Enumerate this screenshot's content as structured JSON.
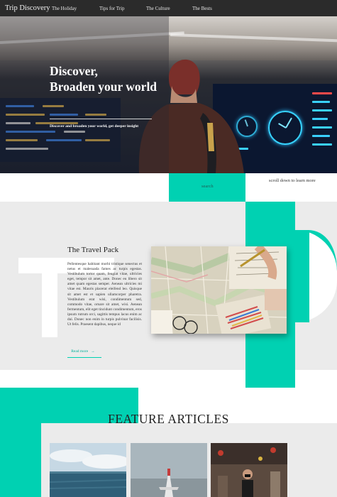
{
  "nav": {
    "brand": "Trip Discovery",
    "links": [
      "The Holiday",
      "Tips for Trip",
      "The Culture",
      "The Bests"
    ]
  },
  "hero": {
    "title_line1": "Discover,",
    "title_line2": "Broaden your world",
    "subtitle": "Discover and broaden your world, get deeper insight"
  },
  "search": {
    "label": "search"
  },
  "scroll_hint": "scroll down to learn more",
  "travel_pack": {
    "title": "The Travel Pack",
    "body": "Pellentesque habitant morbi tristique senectus et netus et malesuada fames ac turpis egestas. Vestibulum tortor quam, feugiat vitae, ultricies eget, tempor sit amet, ante. Donec eu libero sit amet quam egestas semper. Aenean ultricies mi vitae est. Mauris placerat eleifend leo. Quisque sit amet est et sapien ullamcorper pharetra. Vestibulum erat wisi, condimentum sed, commodo vitae, ornare sit amet, wisi. Aenean fermentum, elit eget tincidunt condimentum, eros ipsum rutrum orci, sagittis tempus lacus enim ac dui. Donec non enim in turpis pulvinar facilisis. Ut felis. Praesent dapibus, neque id",
    "read_more": "Read more",
    "arrow": "→"
  },
  "features": {
    "title": "FEATURE ARTICLES"
  },
  "colors": {
    "accent": "#00d1b2",
    "nav_bg": "#2b2b2b",
    "section_gray": "#ebebeb"
  }
}
